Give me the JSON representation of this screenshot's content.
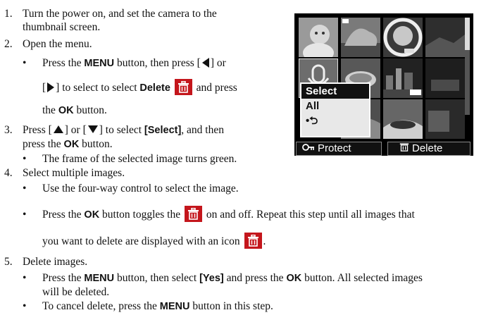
{
  "steps": [
    {
      "num": "1.",
      "lines": [
        "Turn the power on, and set the camera to the",
        "thumbnail screen."
      ]
    },
    {
      "num": "2.",
      "line": "Open the menu."
    },
    {
      "num": "3.",
      "pre": "Press [",
      "mid": "] or [",
      "post": "] to select ",
      "ui": "[Select]",
      "post2": ", and then",
      "line2_pre": "press the ",
      "line2_ui": "OK",
      "line2_post": " button."
    },
    {
      "num": "4.",
      "line": "Select multiple images."
    },
    {
      "num": "5.",
      "line": "Delete images."
    }
  ],
  "step2_bullet": {
    "l1_pre": "Press the ",
    "l1_ui": "MENU",
    "l1_mid": " button, then press [",
    "l1_post": "] or",
    "l2_pre": "[",
    "l2_mid": "] to select to select ",
    "l2_ui": "Delete",
    "l2_post": " and press",
    "l3_pre": "the ",
    "l3_ui": "OK",
    "l3_post": " button."
  },
  "step3_bullet": "The frame of the selected image turns green.",
  "step4_bullet1": "Use the four-way control to select the image.",
  "step4_bullet2": {
    "pre": "Press the ",
    "ui": "OK",
    "mid": " button toggles the ",
    "post": " on and off. Repeat this step until all images that",
    "l2": "you want to delete are displayed with an icon",
    "l2_end": "."
  },
  "step5_bullet1": {
    "pre": "Press the ",
    "ui": "MENU",
    "mid": " button, then select ",
    "ui2": "[Yes]",
    "mid2": " and press the ",
    "ui3": "OK",
    "post": " button. All selected images",
    "l2": "will be deleted."
  },
  "step5_bullet2": {
    "pre": "To cancel delete, press the ",
    "ui": "MENU",
    "post": " button in this step."
  },
  "bullet_char": "•",
  "camera_screen": {
    "menu_options": [
      "Select",
      "All",
      "•⮌"
    ],
    "selected_option": "Select",
    "bottom_left": "Protect",
    "bottom_right": "Delete",
    "bottom_left_icon": "key-icon",
    "bottom_right_icon": "trash-icon"
  },
  "colors": {
    "trash_bg": "#c4161c",
    "screen_bg": "#000000",
    "menu_bg": "#e8e8e8"
  }
}
